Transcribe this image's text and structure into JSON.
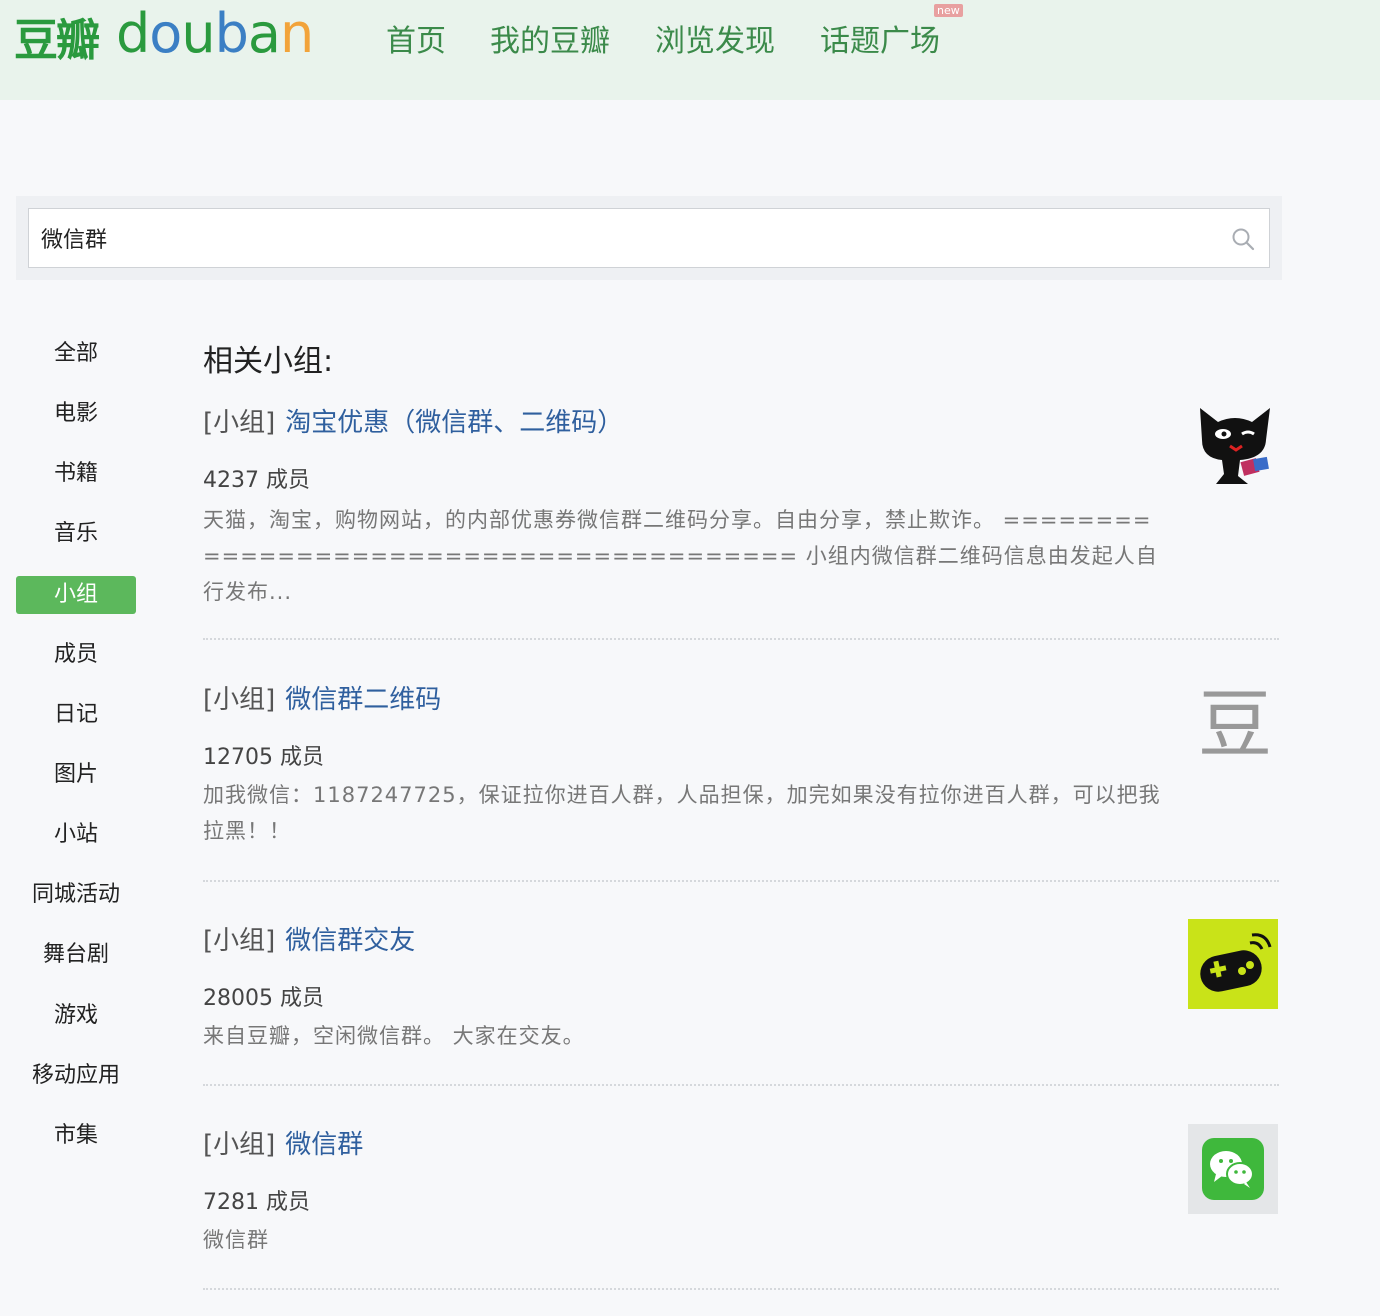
{
  "header": {
    "logo_cn": "豆瓣",
    "logo_en": [
      "d",
      "o",
      "u",
      "b",
      "a",
      "n"
    ],
    "logo_colors": [
      "#2a9a3e",
      "#3b7fc4",
      "#2a9a3e",
      "#3b7fc4",
      "#2a9a3e",
      "#f2a33a"
    ],
    "nav": [
      "首页",
      "我的豆瓣",
      "浏览发现",
      "话题广场"
    ],
    "new_badge": "new"
  },
  "search": {
    "value": "微信群"
  },
  "sidebar": {
    "items": [
      "全部",
      "电影",
      "书籍",
      "音乐",
      "小组",
      "成员",
      "日记",
      "图片",
      "小站",
      "同城活动",
      "舞台剧",
      "游戏",
      "移动应用",
      "市集"
    ],
    "active": "小组"
  },
  "main": {
    "section_title": "相关小组:",
    "results": [
      {
        "type": "[小组]",
        "name": "淘宝优惠（微信群、二维码）",
        "members": "4237 成员",
        "desc": "天猫，淘宝，购物网站，的内部优惠券微信群二维码分享。自由分享，禁止欺诈。 ======================================== 小组内微信群二维码信息由发起人自行发布...",
        "thumb": "black-cat-icon"
      },
      {
        "type": "[小组]",
        "name": "微信群二维码",
        "members": "12705 成员",
        "desc": "加我微信：1187247725，保证拉你进百人群，人品担保，加完如果没有拉你进百人群，可以把我拉黑！！",
        "thumb": "dou-char-icon",
        "thumb_text": "豆"
      },
      {
        "type": "[小组]",
        "name": "微信群交友",
        "members": "28005 成员",
        "desc": "来自豆瓣，空闲微信群。 大家在交友。",
        "thumb": "gamepad-icon"
      },
      {
        "type": "[小组]",
        "name": "微信群",
        "members": "7281 成员",
        "desc": "微信群",
        "thumb": "wechat-icon"
      }
    ]
  }
}
